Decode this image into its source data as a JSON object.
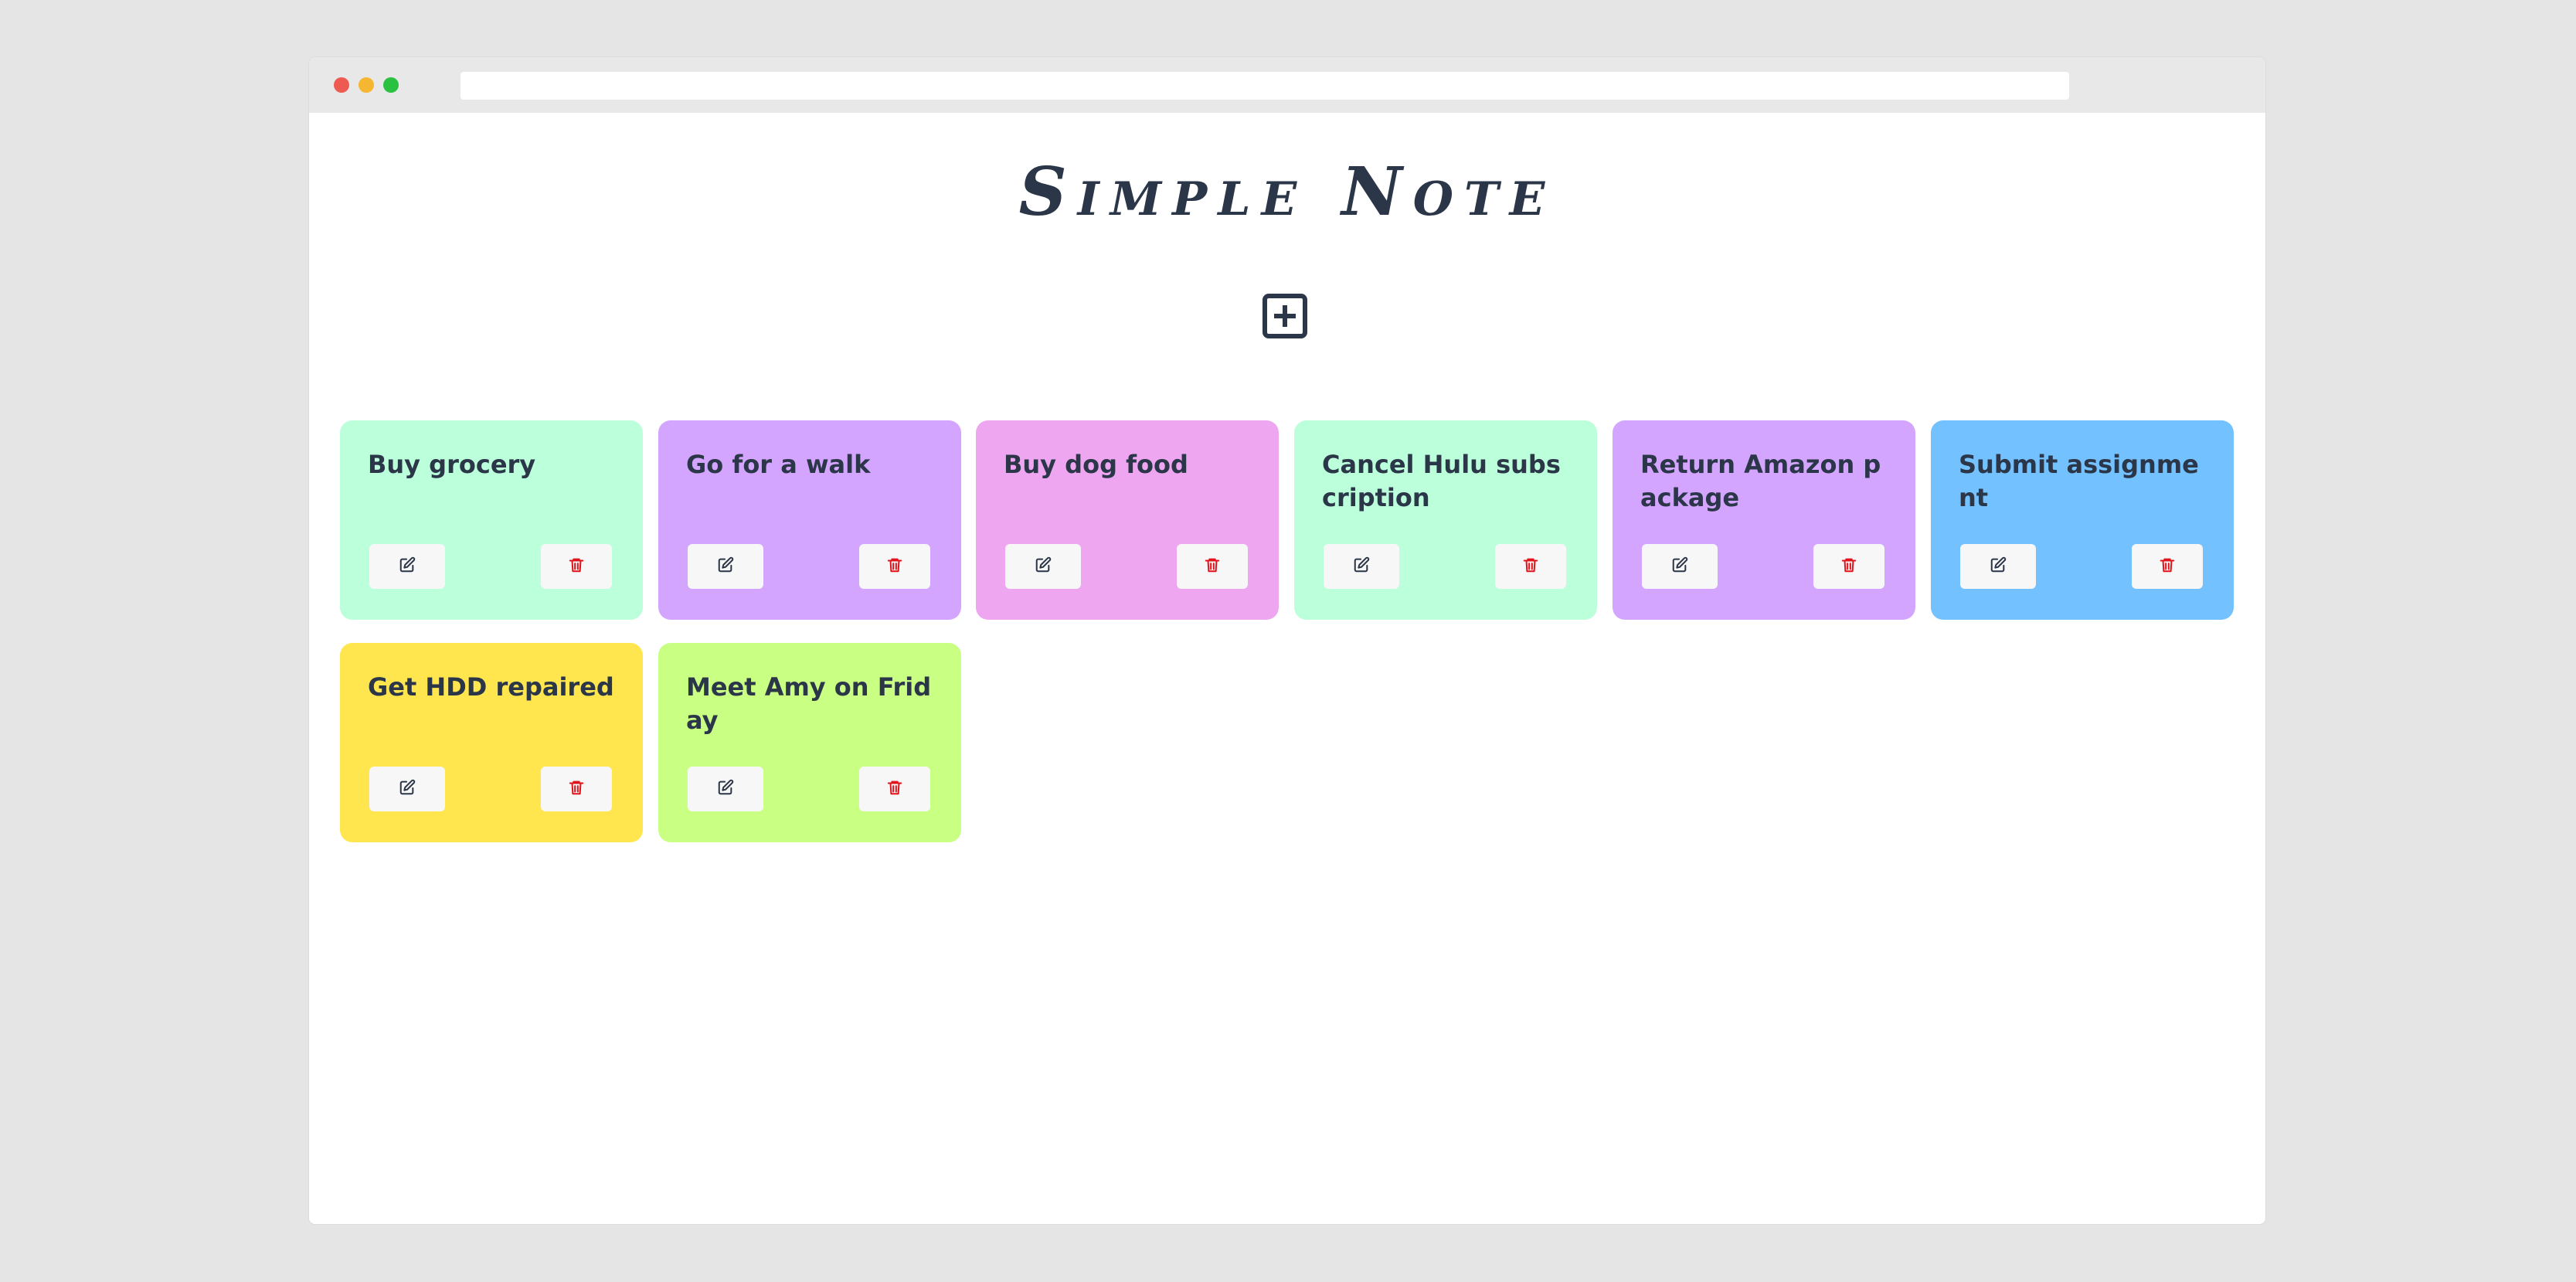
{
  "app": {
    "title": "Simple Note"
  },
  "toolbar": {
    "add_icon": "plus-square-icon"
  },
  "notes": [
    {
      "title": "Buy grocery",
      "color": "#bbffdb"
    },
    {
      "title": "Go for a walk",
      "color": "#d3a5ff"
    },
    {
      "title": "Buy dog food",
      "color": "#eda6ef"
    },
    {
      "title": "Cancel Hulu subscription",
      "color": "#bbffdb"
    },
    {
      "title": "Return Amazon package",
      "color": "#d3a5ff"
    },
    {
      "title": "Submit assignment",
      "color": "#73c1ff"
    },
    {
      "title": "Get HDD repaired",
      "color": "#ffe64f"
    },
    {
      "title": "Meet Amy on Friday",
      "color": "#c9ff83"
    }
  ],
  "note_actions": {
    "edit_icon": "edit-icon",
    "delete_icon": "trash-icon",
    "edit_color": "#2b3648",
    "delete_color": "#e1141c"
  }
}
